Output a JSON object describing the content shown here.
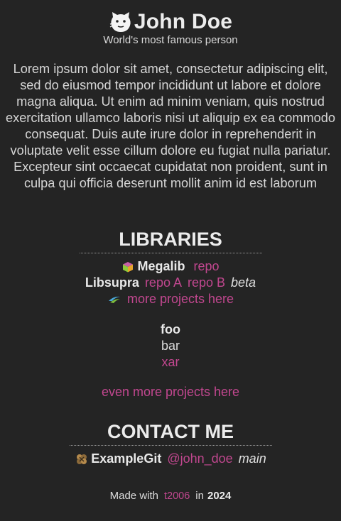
{
  "header": {
    "name": "John Doe",
    "subtitle": "World's most famous person",
    "logo_icon": "cartoon-face-icon"
  },
  "bio": "Lorem ipsum dolor sit amet, consectetur adipiscing elit, sed do eiusmod tempor incididunt ut labore et dolore magna aliqua. Ut enim ad minim veniam, quis nostrud exercitation ullamco laboris nisi ut aliquip ex ea commodo consequat. Duis aute irure dolor in reprehenderit in voluptate velit esse cillum dolore eu fugiat nulla pariatur. Excepteur sint occaecat cupidatat non proident, sunt in culpa qui officia deserunt mollit anim id est laborum",
  "libraries": {
    "heading": "LIBRARIES",
    "megalib": {
      "name": "Megalib",
      "link": "repo",
      "icon": "cube-icon"
    },
    "libsupra": {
      "name": "Libsupra",
      "link_a": "repo A",
      "link_b": "repo B",
      "tag": "beta"
    },
    "more": {
      "link": "more projects here",
      "icon": "swoosh-logo-icon"
    },
    "list": {
      "foo": "foo",
      "bar": "bar",
      "xar": "xar"
    },
    "even_more": "even more projects here"
  },
  "contact": {
    "heading": "CONTACT ME",
    "service": "ExampleGit",
    "handle": "@john_doe",
    "tag": "main",
    "icon": "clover-icon"
  },
  "footer": {
    "made_with": "Made with",
    "tool": "t2006",
    "in": "in",
    "year": "2024"
  },
  "colors": {
    "background": "#242424",
    "text": "#e6e6e6",
    "link": "#c1478f"
  }
}
